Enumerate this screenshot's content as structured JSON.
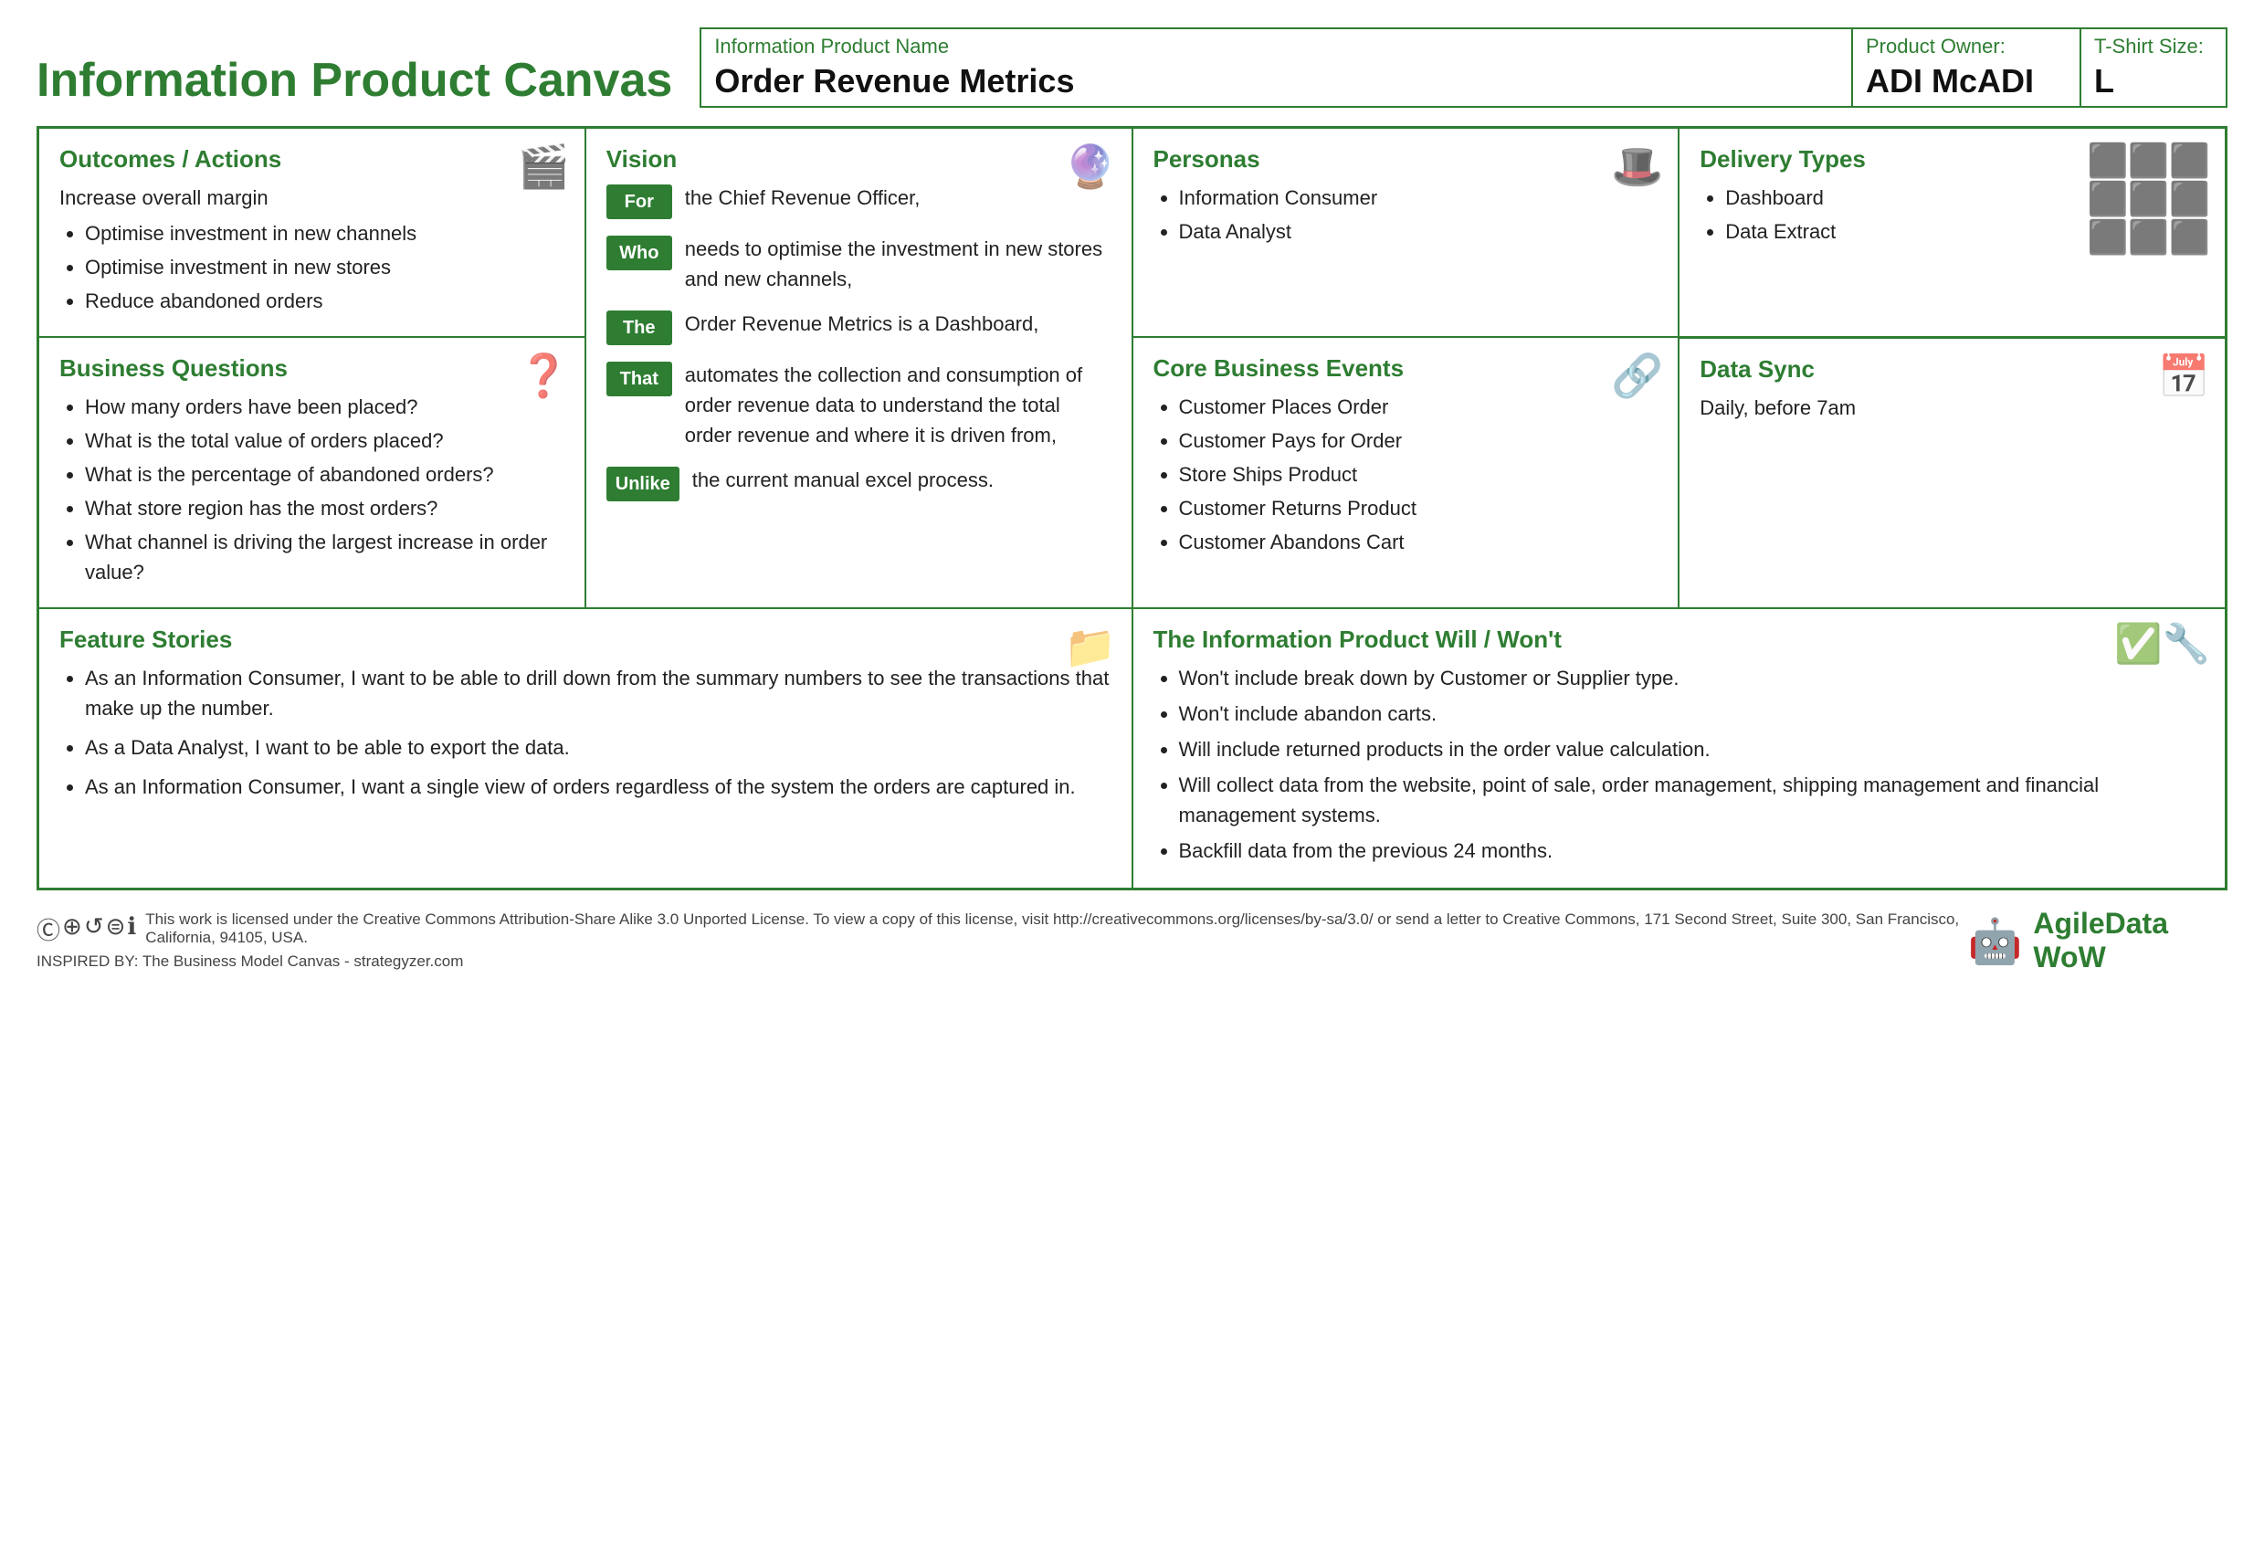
{
  "app": {
    "title": "Information Product Canvas"
  },
  "header": {
    "product_name_label": "Information Product Name",
    "product_name_value": "Order Revenue Metrics",
    "owner_label": "Product Owner:",
    "owner_value": "ADI McADI",
    "size_label": "T-Shirt Size:",
    "size_value": "L"
  },
  "outcomes": {
    "title": "Outcomes / Actions",
    "intro": "Increase overall margin",
    "items": [
      "Optimise investment in new channels",
      "Optimise investment in new stores",
      "Reduce abandoned orders"
    ]
  },
  "vision": {
    "title": "Vision",
    "rows": [
      {
        "label": "For",
        "text": "the Chief Revenue Officer,"
      },
      {
        "label": "Who",
        "text": "needs to optimise the investment in new stores and new channels,"
      },
      {
        "label": "The",
        "text": "Order Revenue Metrics is a Dashboard,"
      },
      {
        "label": "That",
        "text": "automates the collection and consumption of order revenue data to understand the total order revenue and where it is driven from,"
      },
      {
        "label": "Unlike",
        "text": "the current manual excel process."
      }
    ]
  },
  "personas": {
    "title": "Personas",
    "items": [
      "Information Consumer",
      "Data Analyst"
    ]
  },
  "delivery": {
    "title": "Delivery Types",
    "items": [
      "Dashboard",
      "Data Extract"
    ]
  },
  "datasync": {
    "title": "Data Sync",
    "value": "Daily, before 7am"
  },
  "bizq": {
    "title": "Business Questions",
    "items": [
      "How many orders have been placed?",
      "What is the total value of orders placed?",
      "What is the percentage of abandoned orders?",
      "What store region has the most orders?",
      "What channel is driving the largest increase in order value?"
    ]
  },
  "corebiz": {
    "title": "Core Business Events",
    "items": [
      "Customer Places Order",
      "Customer Pays for Order",
      "Store Ships Product",
      "Customer Returns Product",
      "Customer Abandons Cart"
    ]
  },
  "feature": {
    "title": "Feature Stories",
    "items": [
      "As an Information Consumer, I want to be able to drill down from the summary numbers to see the transactions that make up the number.",
      "As a Data Analyst, I want to be able to export the data.",
      "As an Information Consumer, I want a single view of orders regardless of the system the orders are captured in."
    ]
  },
  "willwont": {
    "title": "The Information Product Will / Won't",
    "items": [
      "Won't include break down by Customer or Supplier type.",
      "Won't include abandon carts.",
      "Will include returned products in the order value calculation.",
      "Will collect data from the website, point of sale, order management, shipping management and financial management systems.",
      "Backfill data from the previous 24 months."
    ]
  },
  "footer": {
    "license_text": "This work is licensed under the Creative Commons Attribution-Share Alike 3.0 Unported License. To view a copy of this license, visit http://creativecommons.org/licenses/by-sa/3.0/ or send a letter to Creative Commons, 171 Second Street, Suite 300, San Francisco, California, 94105, USA.",
    "inspired_text": "INSPIRED BY:   The Business Model Canvas - strategyzer.com",
    "brand": "AgileData WoW"
  }
}
